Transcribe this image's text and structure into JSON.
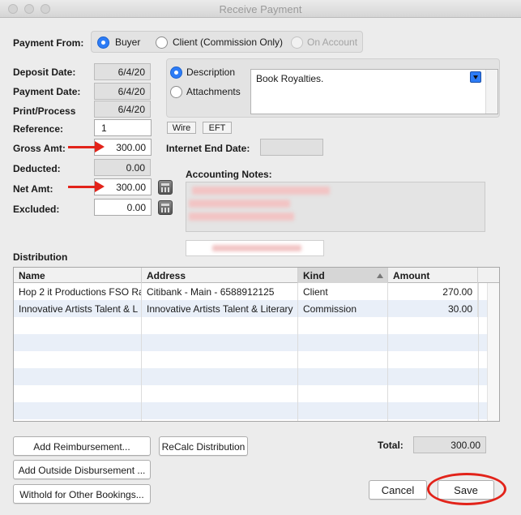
{
  "window": {
    "title": "Receive Payment"
  },
  "payment_from": {
    "label": "Payment From:",
    "options": [
      "Buyer",
      "Client (Commission Only)",
      "On Account"
    ],
    "selected": "Buyer"
  },
  "fields": {
    "deposit_date": {
      "label": "Deposit Date:",
      "value": "6/4/20"
    },
    "payment_date": {
      "label": "Payment Date:",
      "value": "6/4/20"
    },
    "print_process": {
      "label": "Print/Process",
      "value": "6/4/20"
    },
    "reference": {
      "label": "Reference:",
      "value": "1"
    },
    "gross_amt": {
      "label": "Gross Amt:",
      "value": "300.00"
    },
    "deducted": {
      "label": "Deducted:",
      "value": "0.00"
    },
    "net_amt": {
      "label": "Net Amt:",
      "value": "300.00"
    },
    "excluded": {
      "label": "Excluded:",
      "value": "0.00"
    }
  },
  "desc_mode": {
    "options": [
      "Description",
      "Attachments"
    ],
    "selected": "Description",
    "description_text": "Book Royalties."
  },
  "pay_type_buttons": [
    "Wire",
    "EFT"
  ],
  "internet_end_date": {
    "label": "Internet End Date:",
    "value": ""
  },
  "accounting_notes": {
    "label": "Accounting Notes:"
  },
  "distribution": {
    "label": "Distribution",
    "columns": [
      "Name",
      "Address",
      "Kind",
      "Amount"
    ],
    "sorted_column": "Kind",
    "rows": [
      {
        "name": "Hop 2 it Productions FSO Ra",
        "address": "Citibank - Main - 6588912125",
        "kind": "Client",
        "amount": "270.00"
      },
      {
        "name": "Innovative Artists Talent & L",
        "address": "Innovative Artists Talent & Literary",
        "kind": "Commission",
        "amount": "30.00"
      }
    ],
    "empty_rows": 6
  },
  "buttons": {
    "add_reimbursement": "Add Reimbursement...",
    "recalc_distribution": "ReCalc Distribution",
    "add_outside_disbursement": "Add Outside Disbursement ...",
    "withold_other_bookings": "Withold for Other Bookings...",
    "cancel": "Cancel",
    "save": "Save"
  },
  "total": {
    "label": "Total:",
    "value": "300.00"
  },
  "colors": {
    "accent": "#2d7cf6",
    "annotation": "#e2231a",
    "row_alt": "#e9eff8"
  }
}
